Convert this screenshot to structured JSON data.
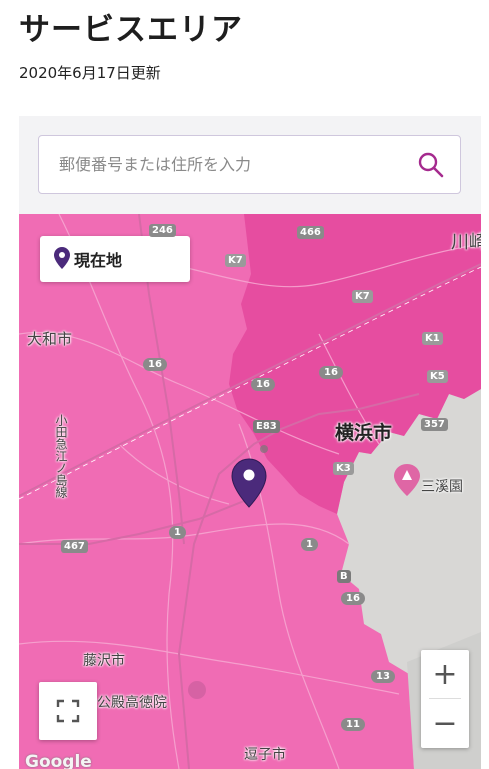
{
  "page": {
    "title": "サービスエリア",
    "updated": "2020年6月17日更新"
  },
  "search": {
    "placeholder": "郵便番号または住所を入力"
  },
  "map": {
    "current_location_label": "現在地",
    "attribution": "Google",
    "coverage_color": "#f06cb4",
    "pin_color": "#4b2a7b",
    "place_labels": {
      "yamato": "大和市",
      "yokohama": "横浜市",
      "sankeien": "三溪園",
      "fujisawa": "藤沢市",
      "kodentoku": "公殿高徳院",
      "zushi": "逗子市",
      "kawasaki": "川崎",
      "odakyu": "小田急江ノ島線"
    },
    "route_badges": {
      "r246": "246",
      "r466": "466",
      "k7a": "K7",
      "k7b": "K7",
      "k1": "K1",
      "k5": "K5",
      "r16a": "16",
      "r16b": "16",
      "r16c": "16",
      "r16d": "16",
      "e83": "E83",
      "k3": "K3",
      "r357": "357",
      "r1a": "1",
      "r1b": "1",
      "r467": "467",
      "b": "B",
      "r13": "13",
      "r11": "11"
    },
    "zoom_in": "+",
    "zoom_out": "−"
  }
}
